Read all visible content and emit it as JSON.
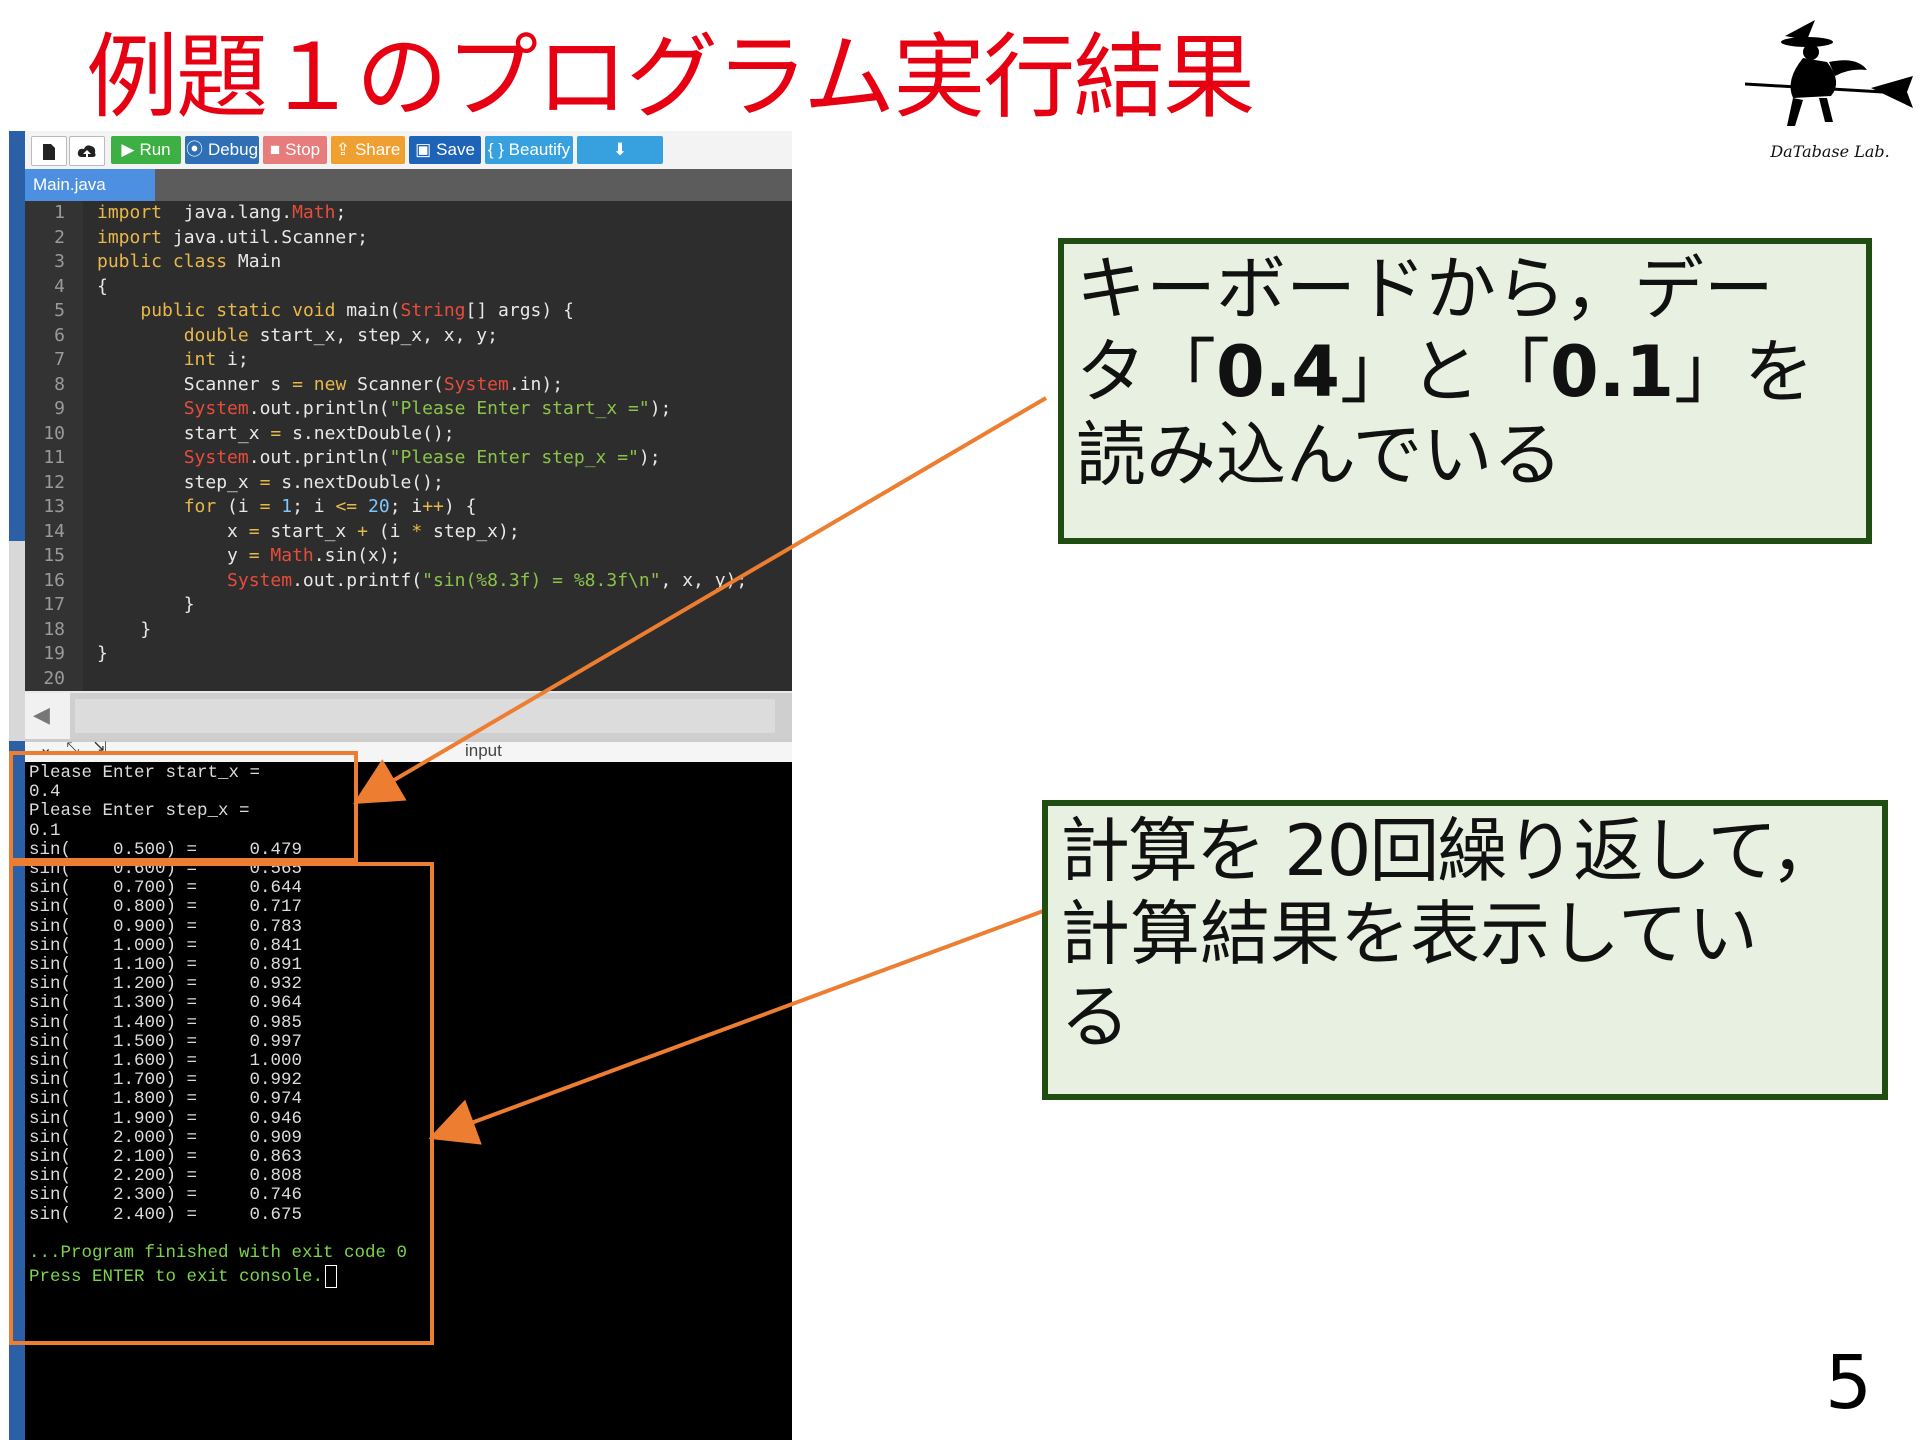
{
  "slide": {
    "title": "例題１のプログラム実行結果",
    "page_number": "5",
    "logo_text": "DaTabase Lab."
  },
  "toolbar": {
    "new_icon": "new-file-icon",
    "upload_icon": "upload-icon",
    "run_label": "Run",
    "debug_label": "Debug",
    "stop_label": "Stop",
    "share_label": "Share",
    "save_label": "Save",
    "beautify_label": "{ } Beautify",
    "download_icon": "download-icon",
    "colors": {
      "run": "#3cb043",
      "debug": "#2f6fb6",
      "stop": "#e87b7b",
      "share": "#f0a030",
      "save": "#1d64b8",
      "beautify": "#37a1e0",
      "download": "#37a1e0"
    }
  },
  "editor": {
    "tab_label": "Main.java",
    "lines": [
      {
        "n": "1",
        "parts": [
          [
            "kw",
            "import"
          ],
          [
            "",
            "  java.lang."
          ],
          [
            "cl",
            "Math"
          ],
          [
            "",
            ";"
          ]
        ]
      },
      {
        "n": "2",
        "parts": [
          [
            "kw",
            "import"
          ],
          [
            "",
            " java.util.Scanner;"
          ]
        ]
      },
      {
        "n": "3",
        "parts": [
          [
            "kw",
            "public"
          ],
          [
            "",
            " "
          ],
          [
            "kw",
            "class"
          ],
          [
            "",
            " Main"
          ]
        ]
      },
      {
        "n": "4",
        "parts": [
          [
            "",
            "{"
          ]
        ]
      },
      {
        "n": "5",
        "parts": [
          [
            "",
            "    "
          ],
          [
            "kw",
            "public"
          ],
          [
            "",
            " "
          ],
          [
            "kw",
            "static"
          ],
          [
            "",
            " "
          ],
          [
            "kw",
            "void"
          ],
          [
            "",
            " main("
          ],
          [
            "cl",
            "String"
          ],
          [
            "",
            "[] args) {"
          ]
        ]
      },
      {
        "n": "6",
        "parts": [
          [
            "",
            "        "
          ],
          [
            "kw",
            "double"
          ],
          [
            "",
            " start_x, step_x, x, y;"
          ]
        ]
      },
      {
        "n": "7",
        "parts": [
          [
            "",
            "        "
          ],
          [
            "kw",
            "int"
          ],
          [
            "",
            " i;"
          ]
        ]
      },
      {
        "n": "8",
        "parts": [
          [
            "",
            "        Scanner s "
          ],
          [
            "op",
            "="
          ],
          [
            "",
            " "
          ],
          [
            "kw",
            "new"
          ],
          [
            "",
            " Scanner("
          ],
          [
            "cl",
            "System"
          ],
          [
            "",
            ".in);"
          ]
        ]
      },
      {
        "n": "9",
        "parts": [
          [
            "",
            "        "
          ],
          [
            "cl",
            "System"
          ],
          [
            "",
            ".out.println("
          ],
          [
            "str",
            "\"Please Enter start_x =\""
          ],
          [
            "",
            ");"
          ]
        ]
      },
      {
        "n": "10",
        "parts": [
          [
            "",
            "        start_x "
          ],
          [
            "op",
            "="
          ],
          [
            "",
            " s.nextDouble();"
          ]
        ]
      },
      {
        "n": "11",
        "parts": [
          [
            "",
            "        "
          ],
          [
            "cl",
            "System"
          ],
          [
            "",
            ".out.println("
          ],
          [
            "str",
            "\"Please Enter step_x =\""
          ],
          [
            "",
            ");"
          ]
        ]
      },
      {
        "n": "12",
        "parts": [
          [
            "",
            "        step_x "
          ],
          [
            "op",
            "="
          ],
          [
            "",
            " s.nextDouble();"
          ]
        ]
      },
      {
        "n": "13",
        "parts": [
          [
            "",
            "        "
          ],
          [
            "kw",
            "for"
          ],
          [
            "",
            " (i "
          ],
          [
            "op",
            "="
          ],
          [
            "",
            " "
          ],
          [
            "num",
            "1"
          ],
          [
            "",
            "; i "
          ],
          [
            "op",
            "<="
          ],
          [
            "",
            " "
          ],
          [
            "num",
            "20"
          ],
          [
            "",
            "; i"
          ],
          [
            "op",
            "++"
          ],
          [
            "",
            ") {"
          ]
        ]
      },
      {
        "n": "14",
        "parts": [
          [
            "",
            "            x "
          ],
          [
            "op",
            "="
          ],
          [
            "",
            " start_x "
          ],
          [
            "op",
            "+"
          ],
          [
            "",
            " (i "
          ],
          [
            "op",
            "*"
          ],
          [
            "",
            " step_x);"
          ]
        ]
      },
      {
        "n": "15",
        "parts": [
          [
            "",
            "            y "
          ],
          [
            "op",
            "="
          ],
          [
            "",
            " "
          ],
          [
            "cl",
            "Math"
          ],
          [
            "",
            ".sin(x);"
          ]
        ]
      },
      {
        "n": "16",
        "parts": [
          [
            "",
            "            "
          ],
          [
            "cl",
            "System"
          ],
          [
            "",
            ".out.printf("
          ],
          [
            "str",
            "\"sin(%8.3f) = %8.3f\\n\""
          ],
          [
            "",
            ", x, y);"
          ]
        ]
      },
      {
        "n": "17",
        "parts": [
          [
            "",
            "        }"
          ]
        ]
      },
      {
        "n": "18",
        "parts": [
          [
            "",
            "    }"
          ]
        ]
      },
      {
        "n": "19",
        "parts": [
          [
            "",
            "}"
          ]
        ]
      },
      {
        "n": "20",
        "parts": [
          [
            "",
            ""
          ]
        ]
      }
    ]
  },
  "io_panel": {
    "label": "input"
  },
  "console": {
    "prompt_lines": [
      "Please Enter start_x =",
      "0.4",
      "Please Enter step_x =",
      "0.1"
    ],
    "results": [
      "sin(    0.500) =     0.479",
      "sin(    0.600) =     0.565",
      "sin(    0.700) =     0.644",
      "sin(    0.800) =     0.717",
      "sin(    0.900) =     0.783",
      "sin(    1.000) =     0.841",
      "sin(    1.100) =     0.891",
      "sin(    1.200) =     0.932",
      "sin(    1.300) =     0.964",
      "sin(    1.400) =     0.985",
      "sin(    1.500) =     0.997",
      "sin(    1.600) =     1.000",
      "sin(    1.700) =     0.992",
      "sin(    1.800) =     0.974",
      "sin(    1.900) =     0.946",
      "sin(    2.000) =     0.909",
      "sin(    2.100) =     0.863",
      "sin(    2.200) =     0.808",
      "sin(    2.300) =     0.746",
      "sin(    2.400) =     0.675"
    ],
    "finish_line": "...Program finished with exit code 0",
    "exit_line": "Press ENTER to exit console."
  },
  "callouts": {
    "input": {
      "line1": "キーボードから，デー",
      "line2_pre": "タ「",
      "value1": "0.4",
      "line2_mid": "」と「",
      "value2": "0.1",
      "line2_post": "」を",
      "line3": "読み込んでいる"
    },
    "output": {
      "line1": "計算を 20回繰り返して，",
      "line2": "計算結果を表示してい",
      "line3": "る"
    }
  }
}
